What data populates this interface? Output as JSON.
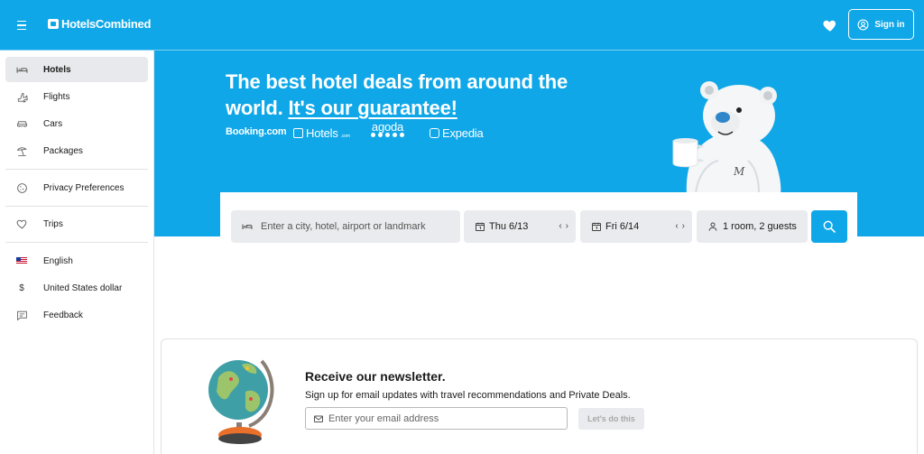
{
  "header": {
    "logo_text": "HotelsCombined",
    "signin_label": "Sign in"
  },
  "sidebar": {
    "items": [
      {
        "label": "Hotels",
        "icon": "bed-icon",
        "active": true
      },
      {
        "label": "Flights",
        "icon": "plane-icon"
      },
      {
        "label": "Cars",
        "icon": "car-icon"
      },
      {
        "label": "Packages",
        "icon": "beach-umbrella-icon"
      },
      {
        "label": "Privacy Preferences",
        "icon": "cookie-icon"
      },
      {
        "label": "Trips",
        "icon": "heart-icon"
      },
      {
        "label": "English",
        "icon": "us-flag-icon"
      },
      {
        "label": "United States dollar",
        "icon": "dollar-icon",
        "symbol": "$"
      },
      {
        "label": "Feedback",
        "icon": "feedback-icon"
      }
    ]
  },
  "hero": {
    "title_line1": "The best hotel deals from around the",
    "title_line2_prefix": "world. ",
    "title_link": "It's our guarantee!",
    "partners": [
      "Booking.com",
      "Hotels",
      "agoda",
      "Expedia"
    ],
    "partner_hotels_suffix": ".com"
  },
  "search": {
    "destination_placeholder": "Enter a city, hotel, airport or landmark",
    "checkin": "Thu 6/13",
    "checkout": "Fri 6/14",
    "guests": "1 room, 2 guests"
  },
  "newsletter": {
    "title": "Receive our newsletter.",
    "subtitle": "Sign up for email updates with travel recommendations and Private Deals.",
    "email_placeholder": "Enter your email address",
    "button_label": "Let's do this"
  },
  "colors": {
    "brand": "#0fa7e8",
    "field_bg": "#eaebee"
  }
}
